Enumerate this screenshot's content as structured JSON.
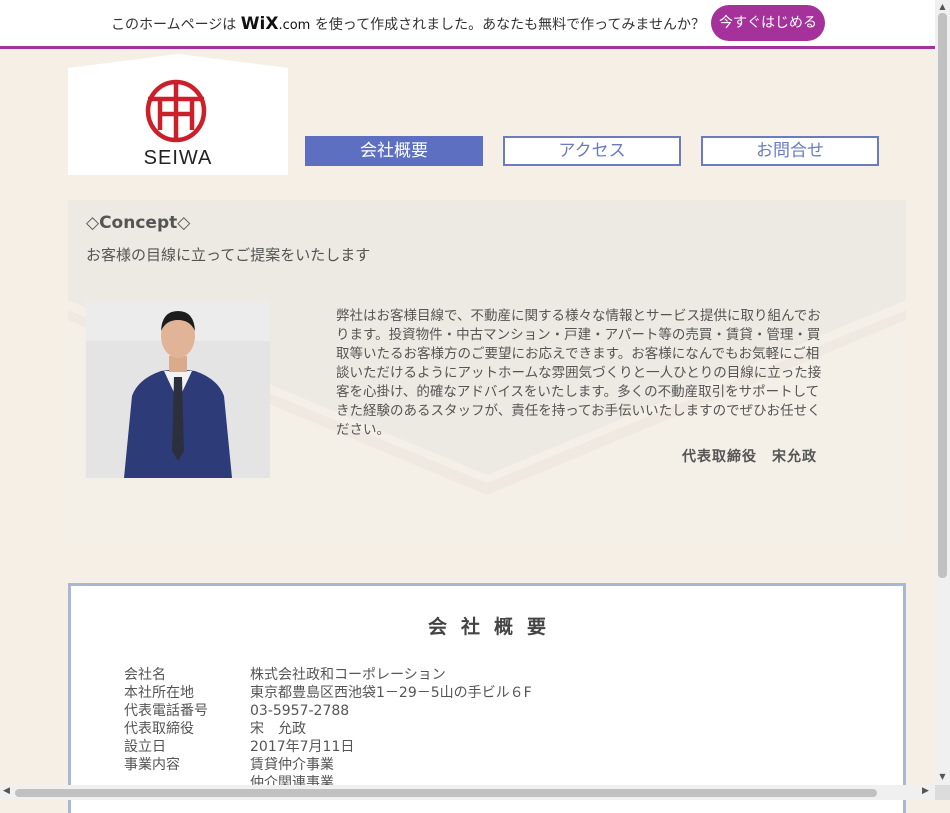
{
  "wix_banner": {
    "text_before": "このホームページは",
    "logo_wix": "WiX",
    "logo_com": ".com",
    "text_after": "を使って作成されました。あなたも無料で作ってみませんか？",
    "cta_label": "今すぐはじめる"
  },
  "header": {
    "logo_text": "SEIWA",
    "nav": [
      {
        "label": "会社概要",
        "active": true
      },
      {
        "label": "アクセス",
        "active": false
      },
      {
        "label": "お問合せ",
        "active": false
      }
    ]
  },
  "concept": {
    "title": "◇Concept◇",
    "subtitle": "お客様の目線に立ってご提案をいたします",
    "body": "弊社はお客様目線で、不動産に関する様々な情報とサービス提供に取り組んでおります。投資物件・中古マンション・戸建・アパート等の売買・賃貸・管理・買取等いたるお客様方のご要望にお応えできます。お客様になんでもお気軽にご相談いただけるようにアットホームな雰囲気づくりと一人ひとりの目線に立った接客を心掛け、的確なアドバイスをいたします。多くの不動産取引をサポートしてきた経験のあるスタッフが、責任を持ってお手伝いいたしますのでぜひお任せください。",
    "signature": "代表取締役　宋允政"
  },
  "company": {
    "title": "会社概要",
    "rows": [
      {
        "label": "会社名",
        "value": "株式会社政和コーポレーション"
      },
      {
        "label": "本社所在地",
        "value": "東京都豊島区西池袋1－29－5山の手ビル６F"
      },
      {
        "label": "代表電話番号",
        "value": "03-5957-2788"
      },
      {
        "label": "代表取締役",
        "value": "宋　允政"
      },
      {
        "label": "設立日",
        "value": "2017年7月11日"
      },
      {
        "label": "事業内容",
        "value": "賃貸仲介事業"
      },
      {
        "label": "",
        "value": "仲介関連事業"
      }
    ]
  },
  "colors": {
    "wix_accent": "#a4329a",
    "nav_active": "#5d6fc0",
    "logo_red": "#cc1f2a",
    "page_bg": "#f5efe6"
  }
}
